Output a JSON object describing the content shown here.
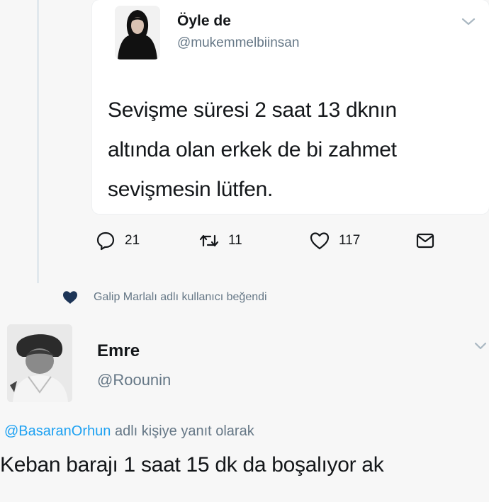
{
  "quoted_tweet": {
    "display_name": "Öyle de",
    "handle": "@mukemmelbiinsan",
    "text_lines": [
      "Sevişme süresi 2 saat 13 dknın",
      "altında olan erkek de bi zahmet",
      "sevişmesin lütfen."
    ],
    "actions": {
      "reply_count": "21",
      "retweet_count": "11",
      "like_count": "117"
    }
  },
  "liked_by": {
    "text": "Galip Marlalı adlı kullanıcı beğendi"
  },
  "reply_tweet": {
    "display_name": "Emre",
    "handle": "@Roounin",
    "replying_to_mention": "@BasaranOrhun",
    "replying_suffix": " adlı kişiye yanıt olarak",
    "text": "Keban barajı 1 saat 15 dk da boşalıyor ak"
  },
  "colors": {
    "text": "#14171a",
    "secondary": "#657786",
    "link": "#1da1f2",
    "thread_line": "#e1e8ed",
    "liked_heart": "#1d3557"
  },
  "icons": [
    "reply-icon",
    "retweet-icon",
    "like-icon",
    "direct-message-icon",
    "chevron-down-icon",
    "heart-filled-icon"
  ]
}
